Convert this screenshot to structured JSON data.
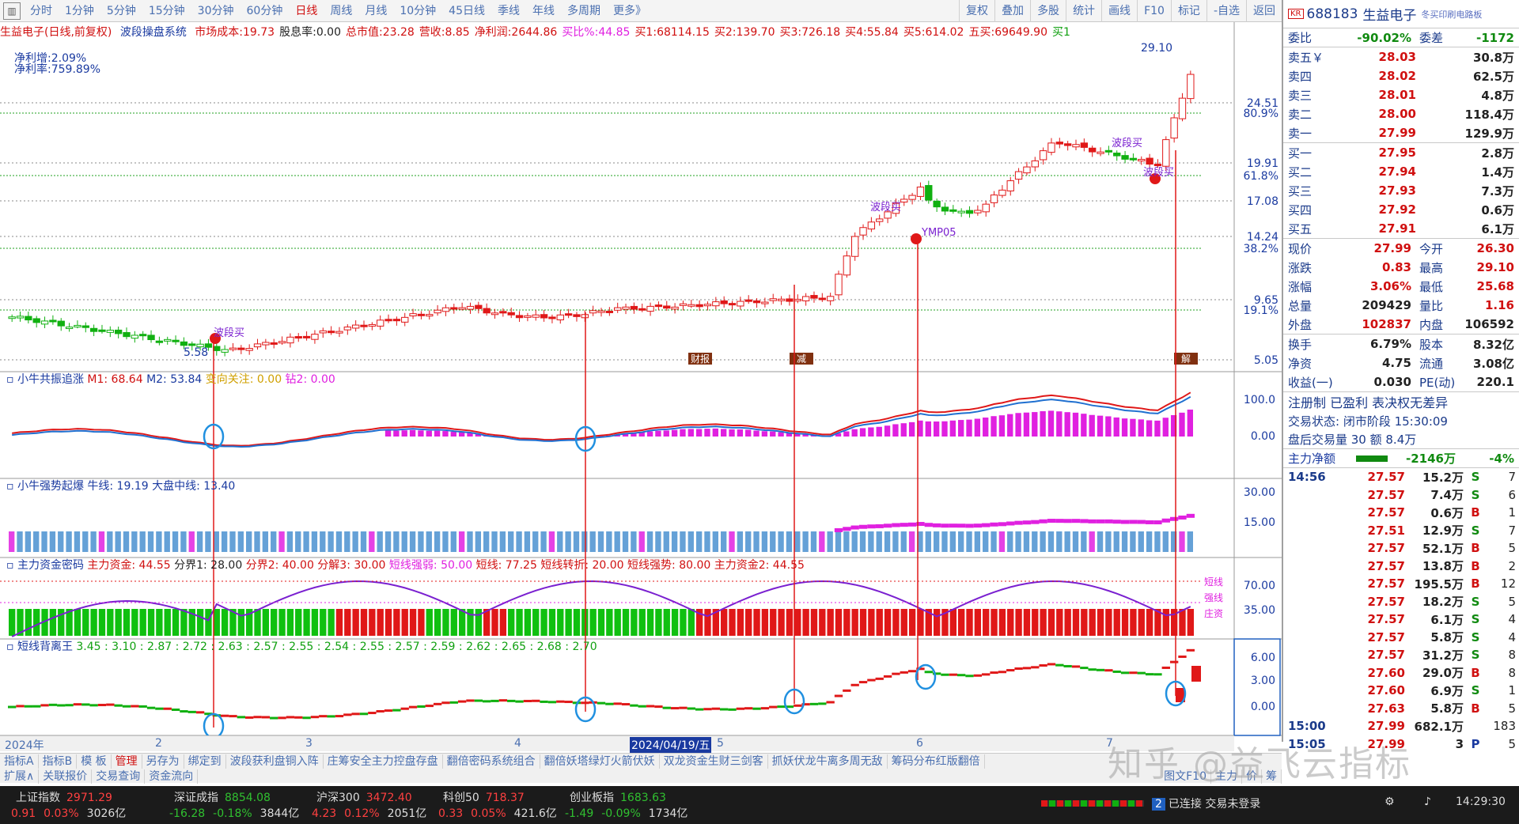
{
  "toolbar": {
    "periods": [
      "分时",
      "1分钟",
      "5分钟",
      "15分钟",
      "30分钟",
      "60分钟",
      "日线",
      "周线",
      "月线",
      "10分钟",
      "45日线",
      "季线",
      "年线",
      "多周期",
      "更多》"
    ],
    "active_period": "日线",
    "right_tools": [
      "复权",
      "叠加",
      "多股",
      "统计",
      "画线",
      "F10",
      "标记",
      "-自选",
      "返回"
    ]
  },
  "chart_header": {
    "title": "生益电子(日线,前复权)",
    "system": "波段操盘系统",
    "items": [
      {
        "label": "市场成本:",
        "value": "19.73",
        "color": "#d01010"
      },
      {
        "label": "股息率:",
        "value": "0.00",
        "color": "#222"
      },
      {
        "label": "总市值:",
        "value": "23.28",
        "color": "#d01010"
      },
      {
        "label": "营收:",
        "value": "8.85",
        "color": "#d01010"
      },
      {
        "label": "净利润:",
        "value": "2644.86",
        "color": "#d01010"
      },
      {
        "label": "买比%:",
        "value": "44.85",
        "color": "#e020e0"
      },
      {
        "label": "买1:",
        "value": "68114.15",
        "color": "#d01010"
      },
      {
        "label": "买2:",
        "value": "139.70",
        "color": "#d01010"
      },
      {
        "label": "买3:",
        "value": "726.18",
        "color": "#d01010"
      },
      {
        "label": "买4:",
        "value": "55.84",
        "color": "#d01010"
      },
      {
        "label": "买5:",
        "value": "614.02",
        "color": "#d01010"
      },
      {
        "label": "五买:",
        "value": "69649.90",
        "color": "#d01010"
      },
      {
        "label": "买1",
        "value": "",
        "color": "#10a010"
      }
    ],
    "net_growth": "净利增:2.09%",
    "net_rate": "净利率:759.89%"
  },
  "price_axis": [
    "24.51",
    "19.91",
    "17.08",
    "14.24",
    "9.65",
    "5.05"
  ],
  "pct_axis": [
    "80.9%",
    "61.8%",
    "38.2%",
    "19.1%"
  ],
  "price_labels": {
    "high": "29.10",
    "low": "5.58"
  },
  "chart_annotations": [
    "波段买",
    "波段买",
    "波段买",
    "波段买",
    "YMP05",
    "跌"
  ],
  "event_tags": [
    "财报",
    "减",
    "解"
  ],
  "panel1": {
    "name": "小牛共振追涨",
    "values": [
      {
        "k": "M1:",
        "v": "68.64",
        "c": "#d01010"
      },
      {
        "k": "M2:",
        "v": "53.84",
        "c": "#1a3aa0"
      },
      {
        "k": "变向关注:",
        "v": "0.00",
        "c": "#d0a000"
      },
      {
        "k": "钻2:",
        "v": "0.00",
        "c": "#e020e0"
      }
    ],
    "axis": [
      "100.0",
      "0.00"
    ]
  },
  "panel2": {
    "name": "小牛强势起爆",
    "values": [
      {
        "k": "牛线:",
        "v": "19.19",
        "c": "#1a3aa0"
      },
      {
        "k": "大盘中线:",
        "v": "13.40",
        "c": "#1a3aa0"
      }
    ],
    "axis": [
      "30.00",
      "15.00"
    ]
  },
  "panel3": {
    "name": "主力资金密码",
    "values": [
      {
        "k": "主力资金:",
        "v": "44.55",
        "c": "#d01010"
      },
      {
        "k": "分界1:",
        "v": "28.00",
        "c": "#222"
      },
      {
        "k": "分界2:",
        "v": "40.00",
        "c": "#d01010"
      },
      {
        "k": "分解3:",
        "v": "30.00",
        "c": "#d01010"
      },
      {
        "k": "短线强弱:",
        "v": "50.00",
        "c": "#e020e0"
      },
      {
        "k": "短线:",
        "v": "77.25",
        "c": "#d01010"
      },
      {
        "k": "短线转折:",
        "v": "20.00",
        "c": "#d01010"
      },
      {
        "k": "短线强势:",
        "v": "80.00",
        "c": "#d01010"
      },
      {
        "k": "主力资金2:",
        "v": "44.55",
        "c": "#d01010"
      }
    ],
    "axis": [
      "70.00",
      "35.00"
    ],
    "right_labels": [
      "短线",
      "强线",
      "庄资"
    ]
  },
  "panel4": {
    "name": "短线背离王",
    "values": "3.45 : 3.10 : 2.87 : 2.72 : 2.63 : 2.57 : 2.55 : 2.54 : 2.55 : 2.57 : 2.59 : 2.62 : 2.65 : 2.68 : 2.70",
    "axis": [
      "6.00",
      "3.00",
      "0.00"
    ]
  },
  "date_axis": {
    "labels": [
      "2024年",
      "2",
      "3",
      "4",
      "5",
      "6",
      "7"
    ],
    "highlight": "2024/04/19/五"
  },
  "indicator_tabs": {
    "row1": [
      "指标A",
      "指标B",
      "模 板",
      "管理",
      "另存为",
      "绑定到",
      "波段获利盘铜入阵",
      "庄筹安全主力控盘存盘",
      "翻倍密码系统组合",
      "翻倍妖塔绿灯火箭伏妖",
      "双龙资金生财三剑客",
      "抓妖伏龙牛离多周无敌",
      "筹码分布红版翻倍"
    ],
    "row2": [
      "扩展∧",
      "关联报价",
      "交易查询",
      "资金流向"
    ],
    "active": "管理",
    "right": [
      "图文F10",
      "主力",
      "价",
      "筹"
    ]
  },
  "right_panel": {
    "badge": "KR",
    "code": "688183",
    "name": "生益电子",
    "sub": "冬买印刷电路板",
    "weibi": {
      "label": "委比",
      "value": "-90.02%",
      "label2": "委差",
      "value2": "-1172"
    },
    "sells": [
      {
        "label": "卖五￥",
        "price": "28.03",
        "vol": "30.8万"
      },
      {
        "label": "卖四",
        "price": "28.02",
        "vol": "62.5万"
      },
      {
        "label": "卖三",
        "price": "28.01",
        "vol": "4.8万"
      },
      {
        "label": "卖二",
        "price": "28.00",
        "vol": "118.4万"
      },
      {
        "label": "卖一",
        "price": "27.99",
        "vol": "129.9万"
      }
    ],
    "buys": [
      {
        "label": "买一",
        "price": "27.95",
        "vol": "2.8万"
      },
      {
        "label": "买二",
        "price": "27.94",
        "vol": "1.4万"
      },
      {
        "label": "买三",
        "price": "27.93",
        "vol": "7.3万"
      },
      {
        "label": "买四",
        "price": "27.92",
        "vol": "0.6万"
      },
      {
        "label": "买五",
        "price": "27.91",
        "vol": "6.1万"
      }
    ],
    "stats": [
      {
        "l1": "现价",
        "v1": "27.99",
        "c1": "red",
        "l2": "今开",
        "v2": "26.30",
        "c2": "red"
      },
      {
        "l1": "涨跌",
        "v1": "0.83",
        "c1": "red",
        "l2": "最高",
        "v2": "29.10",
        "c2": "red"
      },
      {
        "l1": "涨幅",
        "v1": "3.06%",
        "c1": "red",
        "l2": "最低",
        "v2": "25.68",
        "c2": "red"
      },
      {
        "l1": "总量",
        "v1": "209429",
        "c1": "dark",
        "l2": "量比",
        "v2": "1.16",
        "c2": "red"
      },
      {
        "l1": "外盘",
        "v1": "102837",
        "c1": "red",
        "l2": "内盘",
        "v2": "106592",
        "c2": "dark"
      }
    ],
    "stats2": [
      {
        "l1": "换手",
        "v1": "6.79%",
        "c1": "dark",
        "l2": "股本",
        "v2": "8.32亿",
        "c2": "dark"
      },
      {
        "l1": "净资",
        "v1": "4.75",
        "c1": "dark",
        "l2": "流通",
        "v2": "3.08亿",
        "c2": "dark"
      },
      {
        "l1": "收益(一)",
        "v1": "0.030",
        "c1": "dark",
        "l2": "PE(动)",
        "v2": "220.1",
        "c2": "dark"
      }
    ],
    "reg": "注册制 已盈利 表决权无差异",
    "trade_status": "交易状态: 闭市阶段 15:30:09",
    "after_hours": "盘后交易量 30 额 8.4万",
    "main_net": {
      "label": "主力净额",
      "value": "-2146万",
      "pct": "-4%"
    },
    "trades": [
      {
        "t": "14:56",
        "p": "27.57",
        "v": "15.2万",
        "s": "S",
        "n": "7"
      },
      {
        "t": "",
        "p": "27.57",
        "v": "7.4万",
        "s": "S",
        "n": "6"
      },
      {
        "t": "",
        "p": "27.57",
        "v": "0.6万",
        "s": "B",
        "n": "1"
      },
      {
        "t": "",
        "p": "27.51",
        "v": "12.9万",
        "s": "S",
        "n": "7"
      },
      {
        "t": "",
        "p": "27.57",
        "v": "52.1万",
        "s": "B",
        "n": "5"
      },
      {
        "t": "",
        "p": "27.57",
        "v": "13.8万",
        "s": "B",
        "n": "2"
      },
      {
        "t": "",
        "p": "27.57",
        "v": "195.5万",
        "s": "B",
        "n": "12"
      },
      {
        "t": "",
        "p": "27.57",
        "v": "18.2万",
        "s": "S",
        "n": "5"
      },
      {
        "t": "",
        "p": "27.57",
        "v": "6.1万",
        "s": "S",
        "n": "4"
      },
      {
        "t": "",
        "p": "27.57",
        "v": "5.8万",
        "s": "S",
        "n": "4"
      },
      {
        "t": "",
        "p": "27.57",
        "v": "31.2万",
        "s": "S",
        "n": "8"
      },
      {
        "t": "",
        "p": "27.60",
        "v": "29.0万",
        "s": "B",
        "n": "8"
      },
      {
        "t": "",
        "p": "27.60",
        "v": "6.9万",
        "s": "S",
        "n": "1"
      },
      {
        "t": "",
        "p": "27.63",
        "v": "5.8万",
        "s": "B",
        "n": "5"
      },
      {
        "t": "15:00",
        "p": "27.99",
        "v": "682.1万",
        "s": "",
        "n": "183"
      },
      {
        "t": "15:05",
        "p": "27.99",
        "v": "3",
        "s": "P",
        "n": "5"
      }
    ]
  },
  "status_bar": {
    "indices": [
      {
        "name": "上证指数",
        "value": "2971.29",
        "change": "0.91",
        "pct": "0.03%",
        "amount": "3026亿",
        "up": true
      },
      {
        "name": "深证成指",
        "value": "8854.08",
        "change": "-16.28",
        "pct": "-0.18%",
        "amount": "3844亿",
        "up": false
      },
      {
        "name": "沪深300",
        "value": "3472.40",
        "change": "4.23",
        "pct": "0.12%",
        "amount": "2051亿",
        "up": true
      },
      {
        "name": "科创50",
        "value": "718.37",
        "change": "0.33",
        "pct": "0.05%",
        "amount": "421.6亿",
        "up": true
      },
      {
        "name": "创业板指",
        "value": "1683.63",
        "change": "-1.49",
        "pct": "-0.09%",
        "amount": "1734亿",
        "up": false
      }
    ],
    "connection": "已连接 交易未登录",
    "conn_num": "2",
    "time": "14:29:30"
  },
  "watermark": "知乎 @益飞云指标",
  "colors": {
    "up": "#e01818",
    "down": "#10b010",
    "accent": "#1a3aa0",
    "magenta": "#e020e0",
    "purple": "#7a20d0"
  }
}
